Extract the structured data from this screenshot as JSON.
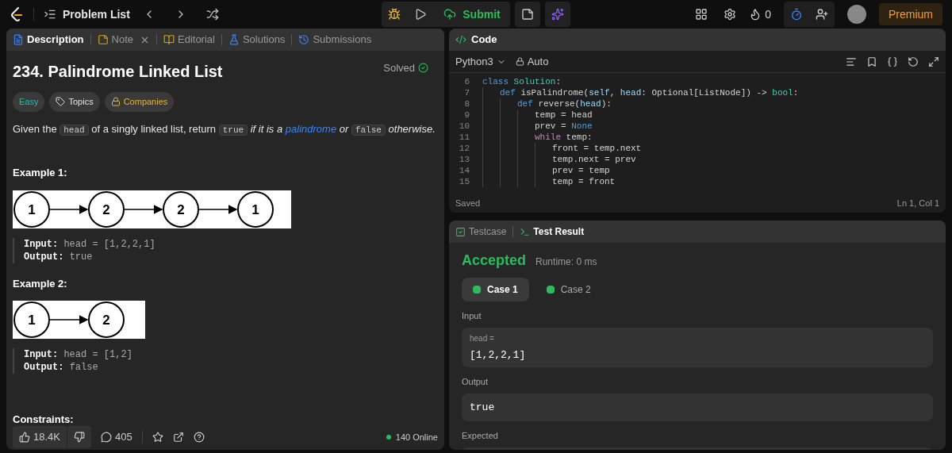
{
  "topbar": {
    "title": "Problem List",
    "submit": "Submit",
    "streak": "0",
    "premium": "Premium"
  },
  "description_panel": {
    "tabs": [
      {
        "label": "Description",
        "selected": true,
        "kind": "description",
        "closable": false
      },
      {
        "label": "Note",
        "selected": false,
        "kind": "note",
        "closable": true
      },
      {
        "label": "Editorial",
        "selected": false,
        "kind": "editorial",
        "closable": false
      },
      {
        "label": "Solutions",
        "selected": false,
        "kind": "solutions",
        "closable": false
      },
      {
        "label": "Submissions",
        "selected": false,
        "kind": "submissions",
        "closable": false
      }
    ],
    "title": "234. Palindrome Linked List",
    "status": "Solved",
    "tags": [
      {
        "label": "Easy",
        "kind": "difficulty"
      },
      {
        "label": "Topics",
        "kind": "topics"
      },
      {
        "label": "Companies",
        "kind": "companies"
      }
    ],
    "statement": [
      {
        "text": "Given the ",
        "kind": "text"
      },
      {
        "text": "head",
        "kind": "code"
      },
      {
        "text": " of a singly linked list, return ",
        "kind": "text"
      },
      {
        "text": "true",
        "kind": "code"
      },
      {
        "text": " if it is a ",
        "kind": "italic"
      },
      {
        "text": "palindrome",
        "kind": "link"
      },
      {
        "text": " or ",
        "kind": "italic"
      },
      {
        "text": "false",
        "kind": "code"
      },
      {
        "text": " otherwise.",
        "kind": "italic"
      }
    ],
    "examples": [
      {
        "heading": "Example 1:",
        "nodes": [
          "1",
          "2",
          "2",
          "1"
        ],
        "input_label": "Input:",
        "input": "head = [1,2,2,1]",
        "output_label": "Output:",
        "output": "true"
      },
      {
        "heading": "Example 2:",
        "nodes": [
          "1",
          "2"
        ],
        "input_label": "Input:",
        "input": "head = [1,2]",
        "output_label": "Output:",
        "output": "false"
      }
    ],
    "constraints_heading": "Constraints:",
    "footer": {
      "likes": "18.4K",
      "comments": "405",
      "online": "140 Online"
    }
  },
  "code_panel": {
    "title": "Code",
    "language": "Python3",
    "mode": "Auto",
    "lines": [
      {
        "number": "6",
        "tokens": [
          {
            "text": "class ",
            "kind": "keyword"
          },
          {
            "text": "Solution",
            "kind": "type"
          },
          {
            "text": ":",
            "kind": "plain"
          }
        ],
        "children": [
          {
            "number": "7",
            "tokens": [
              {
                "text": "def ",
                "kind": "keyword"
              },
              {
                "text": "isPalindrome(",
                "kind": "plain"
              },
              {
                "text": "self",
                "kind": "param"
              },
              {
                "text": ", ",
                "kind": "plain"
              },
              {
                "text": "head",
                "kind": "param"
              },
              {
                "text": ": Optional[ListNode]) -> ",
                "kind": "plain"
              },
              {
                "text": "bool",
                "kind": "type"
              },
              {
                "text": ":",
                "kind": "plain"
              }
            ],
            "children": [
              {
                "number": "8",
                "tokens": [
                  {
                    "text": "def ",
                    "kind": "keyword"
                  },
                  {
                    "text": "reverse(",
                    "kind": "plain"
                  },
                  {
                    "text": "head",
                    "kind": "param"
                  },
                  {
                    "text": "):",
                    "kind": "plain"
                  }
                ],
                "children": [
                  {
                    "number": "9",
                    "tokens": [
                      {
                        "text": "temp = head",
                        "kind": "plain"
                      }
                    ]
                  },
                  {
                    "number": "10",
                    "tokens": [
                      {
                        "text": "prev = ",
                        "kind": "plain"
                      },
                      {
                        "text": "None",
                        "kind": "keyword"
                      }
                    ]
                  },
                  {
                    "number": "11",
                    "tokens": [
                      {
                        "text": "while ",
                        "kind": "control"
                      },
                      {
                        "text": "temp:",
                        "kind": "plain"
                      }
                    ],
                    "children": [
                      {
                        "number": "12",
                        "tokens": [
                          {
                            "text": "front = temp.next",
                            "kind": "plain"
                          }
                        ]
                      },
                      {
                        "number": "13",
                        "tokens": [
                          {
                            "text": "temp.next = prev",
                            "kind": "plain"
                          }
                        ]
                      },
                      {
                        "number": "14",
                        "tokens": [
                          {
                            "text": "prev = temp",
                            "kind": "plain"
                          }
                        ]
                      },
                      {
                        "number": "15",
                        "tokens": [
                          {
                            "text": "temp = front",
                            "kind": "plain"
                          }
                        ]
                      }
                    ]
                  }
                ]
              }
            ]
          }
        ]
      }
    ],
    "status": "Saved",
    "cursor": "Ln 1, Col 1"
  },
  "result_panel": {
    "tabs": [
      {
        "label": "Testcase",
        "selected": false,
        "kind": "testcase"
      },
      {
        "label": "Test Result",
        "selected": true,
        "kind": "result"
      }
    ],
    "verdict": "Accepted",
    "runtime": "Runtime: 0 ms",
    "cases": [
      {
        "label": "Case 1",
        "selected": true,
        "passed": true
      },
      {
        "label": "Case 2",
        "selected": false,
        "passed": true
      }
    ],
    "input_label": "Input",
    "input_name": "head =",
    "input_value": "[1,2,2,1]",
    "output_label": "Output",
    "output_value": "true",
    "expected_label": "Expected"
  }
}
